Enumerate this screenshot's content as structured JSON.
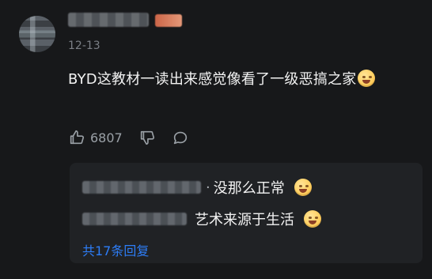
{
  "comment": {
    "date": "12-13",
    "text": "BYD这教材一读出来感觉像看了一级恶搞之家",
    "emoji": "laughing-with-tears-emoji",
    "likes": "6807"
  },
  "replies": {
    "items": [
      {
        "separator": "·",
        "text": "没那么正常",
        "emoji": "grinning-sweat-emoji"
      },
      {
        "separator": "",
        "text": "艺术来源于生活",
        "emoji": "blushing-emoji"
      }
    ],
    "more_label": "共17条回复"
  },
  "colors": {
    "background": "#17181a",
    "reply_box": "#202225",
    "text": "#f2f2f2",
    "secondary": "#7b7f86",
    "link": "#2d7df7"
  }
}
